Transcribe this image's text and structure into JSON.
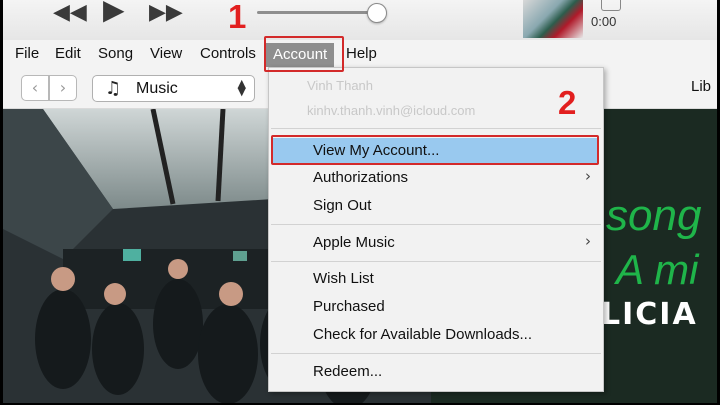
{
  "player": {
    "time": "0:00",
    "icons": [
      "rewind-icon",
      "play-icon",
      "fast-forward-icon"
    ]
  },
  "menubar": {
    "items": [
      "File",
      "Edit",
      "Song",
      "View",
      "Controls",
      "Account",
      "Help"
    ],
    "active": "Account"
  },
  "toolbar": {
    "back_glyph": "‹",
    "forward_glyph": "›",
    "media_select": "Music",
    "library_label": "Lib"
  },
  "account_menu": {
    "user_name": "Vinh Thanh",
    "user_email": "kinhv.thanh.vinh@icloud.com",
    "items": [
      {
        "label": "View My Account...",
        "highlighted": true
      },
      {
        "label": "Authorizations",
        "submenu": true
      },
      {
        "label": "Sign Out"
      },
      {
        "label": "Apple Music",
        "submenu": true
      },
      {
        "label": "Wish List"
      },
      {
        "label": "Purchased"
      },
      {
        "label": "Check for Available Downloads..."
      },
      {
        "label": "Redeem..."
      }
    ]
  },
  "banner": {
    "line1": "song",
    "line2": "A mi",
    "line3": "LICIA"
  },
  "annotations": {
    "step1": "1",
    "step2": "2"
  },
  "colors": {
    "highlight": "#99c9ef",
    "annotation_red": "#d32a2a",
    "menu_active": "#8e8e8e"
  }
}
